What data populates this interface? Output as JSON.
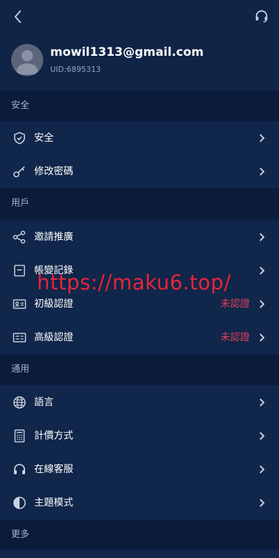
{
  "profile": {
    "email": "mowil1313@gmail.com",
    "uid": "UID:6895313"
  },
  "sections": {
    "security": {
      "title": "安全",
      "items": [
        "安全",
        "修改密碼"
      ]
    },
    "user": {
      "title": "用戶",
      "items": [
        "邀請推廣",
        "帳變記錄",
        "初級認證",
        "高級認證"
      ]
    },
    "general": {
      "title": "通用",
      "items": [
        "語言",
        "計價方式",
        "在線客服",
        "主題模式"
      ]
    },
    "more": {
      "title": "更多"
    }
  },
  "status": {
    "basic_verification": "未認證",
    "advanced_verification": "未認證"
  },
  "watermark": "https://maku6.top/",
  "colors": {
    "background": "#0f2447",
    "section_background": "#0b1c3a",
    "status_red": "#e0405c",
    "watermark_red": "#e8243a"
  }
}
